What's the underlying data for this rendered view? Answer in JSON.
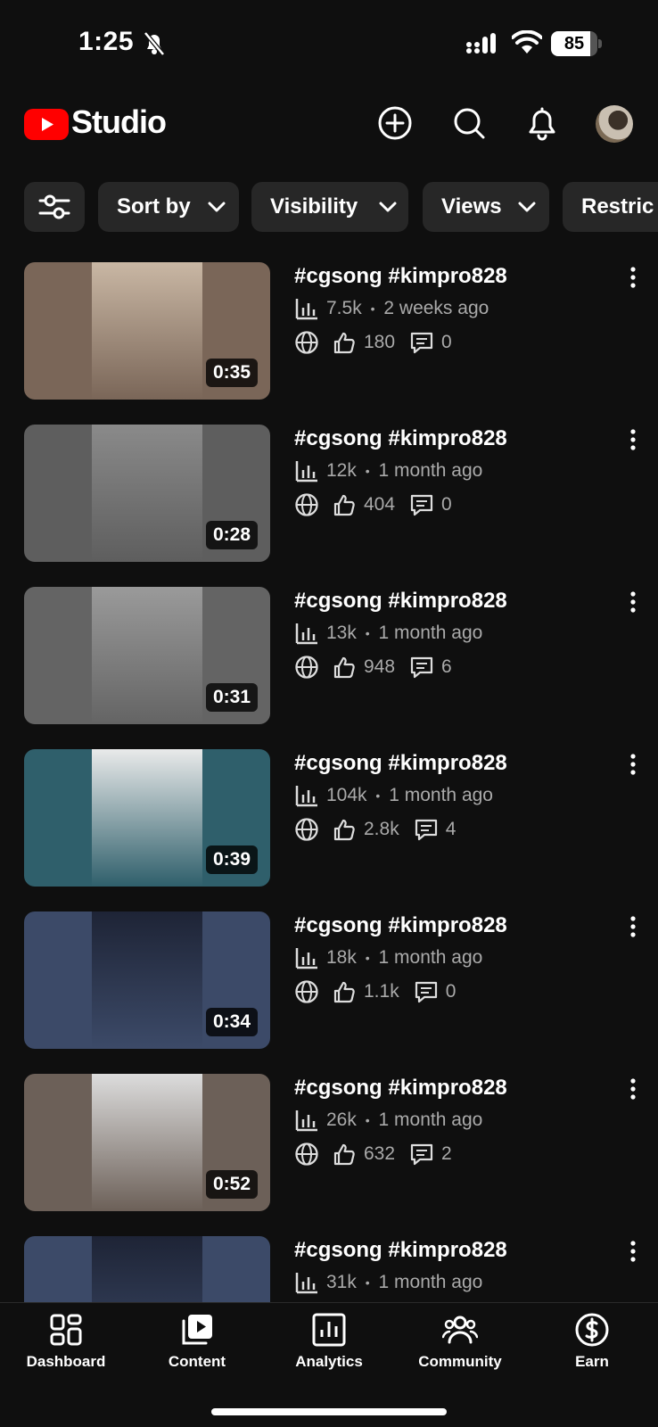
{
  "status_bar": {
    "time": "1:25",
    "battery": "85",
    "battery_level": 0.85
  },
  "header": {
    "brand": "Studio",
    "logo_color": "#ff0000"
  },
  "filters": [
    {
      "label": "Sort by",
      "has_dropdown": true
    },
    {
      "label": "Visibility",
      "has_dropdown": true
    },
    {
      "label": "Views",
      "has_dropdown": true
    },
    {
      "label": "Restric",
      "has_dropdown": false
    }
  ],
  "videos": [
    {
      "title": "#cgsong #kimpro828",
      "views": "7.5k",
      "age": "2 weeks ago",
      "likes": "180",
      "comments": "0",
      "duration": "0:35",
      "thumb_bg": "#7a6658",
      "thumb_inner": "#c9b7a4"
    },
    {
      "title": "#cgsong #kimpro828",
      "views": "12k",
      "age": "1 month ago",
      "likes": "404",
      "comments": "0",
      "duration": "0:28",
      "thumb_bg": "#5e5e5e",
      "thumb_inner": "#8a8a8a"
    },
    {
      "title": "#cgsong #kimpro828",
      "views": "13k",
      "age": "1 month ago",
      "likes": "948",
      "comments": "6",
      "duration": "0:31",
      "thumb_bg": "#646464",
      "thumb_inner": "#9a9a9a"
    },
    {
      "title": "#cgsong #kimpro828",
      "views": "104k",
      "age": "1 month ago",
      "likes": "2.8k",
      "comments": "4",
      "duration": "0:39",
      "thumb_bg": "#2f5f6b",
      "thumb_inner": "#e9eaea"
    },
    {
      "title": "#cgsong #kimpro828",
      "views": "18k",
      "age": "1 month ago",
      "likes": "1.1k",
      "comments": "0",
      "duration": "0:34",
      "thumb_bg": "#3c4a68",
      "thumb_inner": "#1e2436"
    },
    {
      "title": "#cgsong #kimpro828",
      "views": "26k",
      "age": "1 month ago",
      "likes": "632",
      "comments": "2",
      "duration": "0:52",
      "thumb_bg": "#6c6058",
      "thumb_inner": "#dcdcdc"
    },
    {
      "title": "#cgsong  #kimpro828",
      "views": "31k",
      "age": "1 month ago",
      "likes": "",
      "comments": "",
      "duration": "",
      "thumb_bg": "#3c4a68",
      "thumb_inner": "#1e2436"
    }
  ],
  "bottom_nav": [
    {
      "label": "Dashboard",
      "icon": "dashboard-icon"
    },
    {
      "label": "Content",
      "icon": "content-icon"
    },
    {
      "label": "Analytics",
      "icon": "analytics-icon"
    },
    {
      "label": "Community",
      "icon": "community-icon"
    },
    {
      "label": "Earn",
      "icon": "earn-icon"
    }
  ]
}
